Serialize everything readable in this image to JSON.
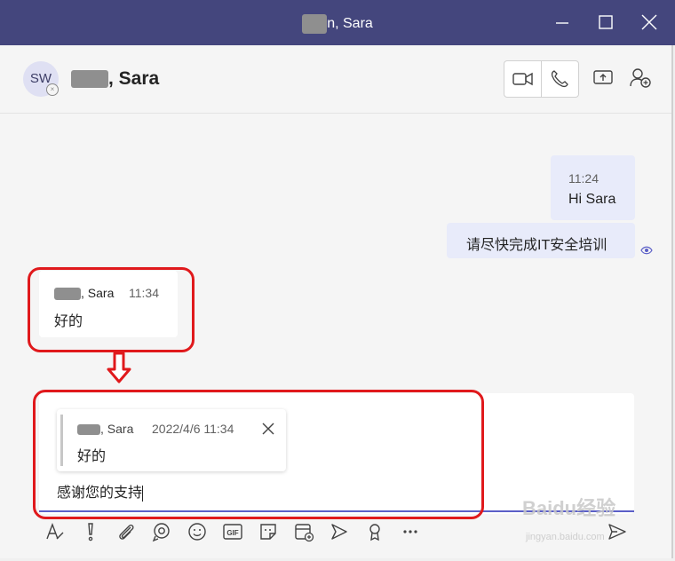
{
  "window": {
    "title_suffix": "n, Sara"
  },
  "header": {
    "avatar_initials": "SW",
    "name_suffix": ", Sara"
  },
  "messages_sent": [
    {
      "time": "11:24",
      "text": "Hi Sara"
    },
    {
      "text": "请尽快完成IT安全培训"
    }
  ],
  "message_received": {
    "sender_suffix": ", Sara",
    "time": "11:34",
    "text": "好的"
  },
  "compose": {
    "quote": {
      "sender_suffix": ", Sara",
      "timestamp": "2022/4/6 11:34",
      "text": "好的"
    },
    "draft_text": "感谢您的支持"
  },
  "toolbar_icons": [
    "format-icon",
    "important-icon",
    "attach-icon",
    "loop-icon",
    "emoji-icon",
    "gif-icon",
    "sticker-icon",
    "schedule-meeting-icon",
    "stream-icon",
    "praise-icon",
    "more-icon",
    "send-icon"
  ],
  "watermark": {
    "text": "Baidu经验",
    "url_text": "jingyan.baidu.com"
  },
  "colors": {
    "titlebar": "#44467d",
    "accent": "#5b5fc7",
    "annotation_red": "#e0191c"
  }
}
